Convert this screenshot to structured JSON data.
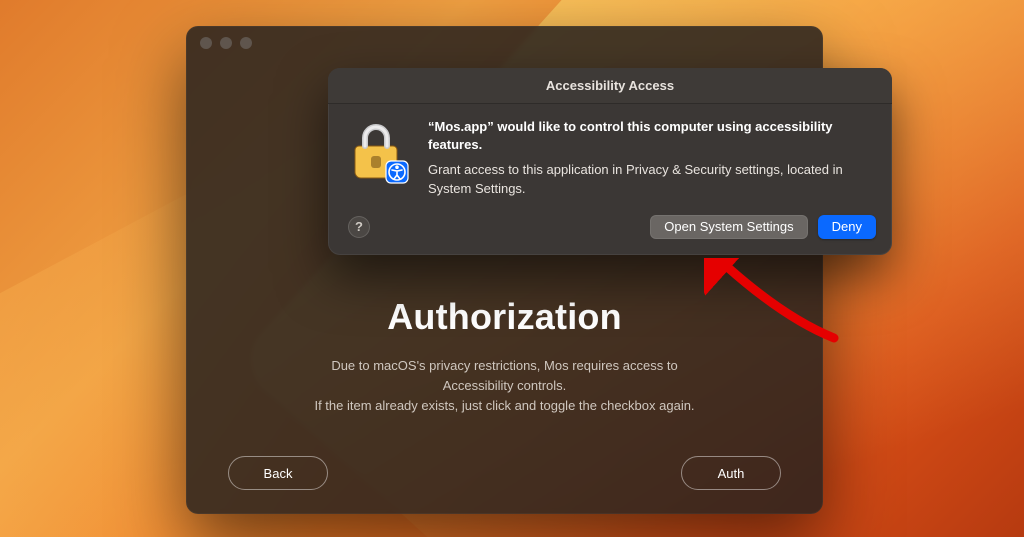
{
  "authWindow": {
    "title": "Authorization",
    "description_lines": [
      "Due to macOS's privacy restrictions, Mos requires access to",
      "Accessibility controls.",
      "If the item already exists, just click and toggle the checkbox again."
    ],
    "back_button": "Back",
    "auth_button": "Auth"
  },
  "alert": {
    "title": "Accessibility Access",
    "headline": "“Mos.app” would like to control this computer using accessibility features.",
    "subtext": "Grant access to this application in Privacy & Security settings, located in System Settings.",
    "help_label": "?",
    "open_settings_button": "Open System Settings",
    "deny_button": "Deny"
  }
}
